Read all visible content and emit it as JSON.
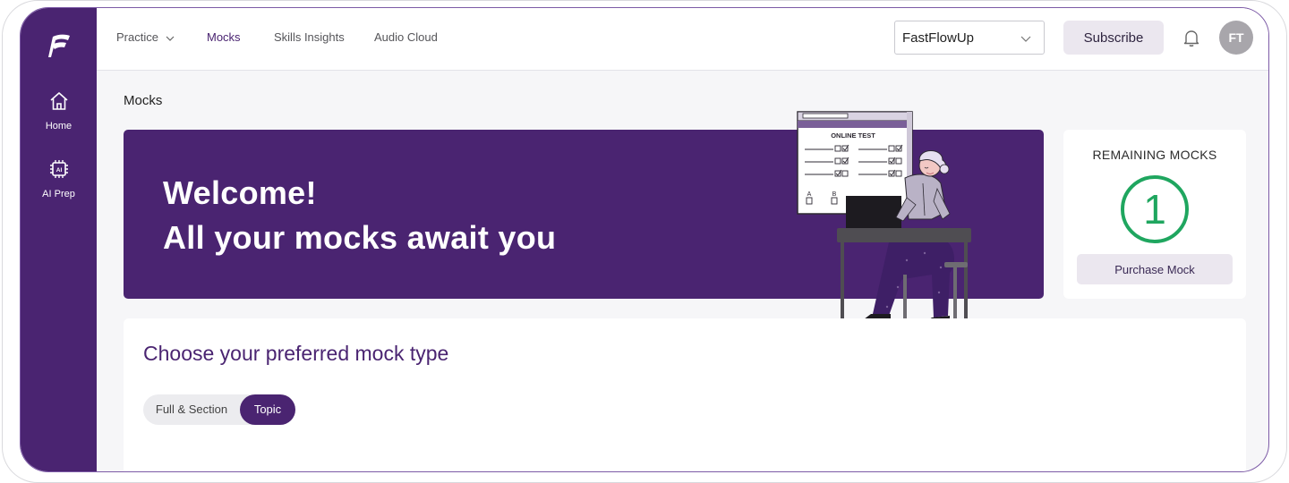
{
  "sidebar": {
    "logo": "fastflow-logo",
    "items": [
      {
        "label": "Home",
        "icon": "home-icon"
      },
      {
        "label": "AI Prep",
        "icon": "ai-chip-icon"
      }
    ]
  },
  "topnav": {
    "items": [
      {
        "label": "Practice",
        "has_dropdown": true
      },
      {
        "label": "Mocks",
        "active": true
      },
      {
        "label": "Skills Insights"
      },
      {
        "label": "Audio Cloud"
      }
    ],
    "org_select": {
      "value": "FastFlowUp"
    },
    "subscribe_label": "Subscribe",
    "avatar_initials": "FT"
  },
  "page": {
    "title": "Mocks",
    "banner": {
      "line1": "Welcome!",
      "line2": "All your mocks await you",
      "illustration_text": "ONLINE TEST",
      "option_a": "A",
      "option_b": "B"
    },
    "remaining": {
      "title": "REMAINING MOCKS",
      "count": "1",
      "purchase_label": "Purchase Mock"
    },
    "mock_type": {
      "heading": "Choose your preferred mock type",
      "options": [
        "Full & Section",
        "Topic"
      ],
      "selected": "Topic"
    }
  },
  "colors": {
    "brand_purple": "#4a2471",
    "success_green": "#1fa65f",
    "button_bg": "#ebe7ef"
  }
}
